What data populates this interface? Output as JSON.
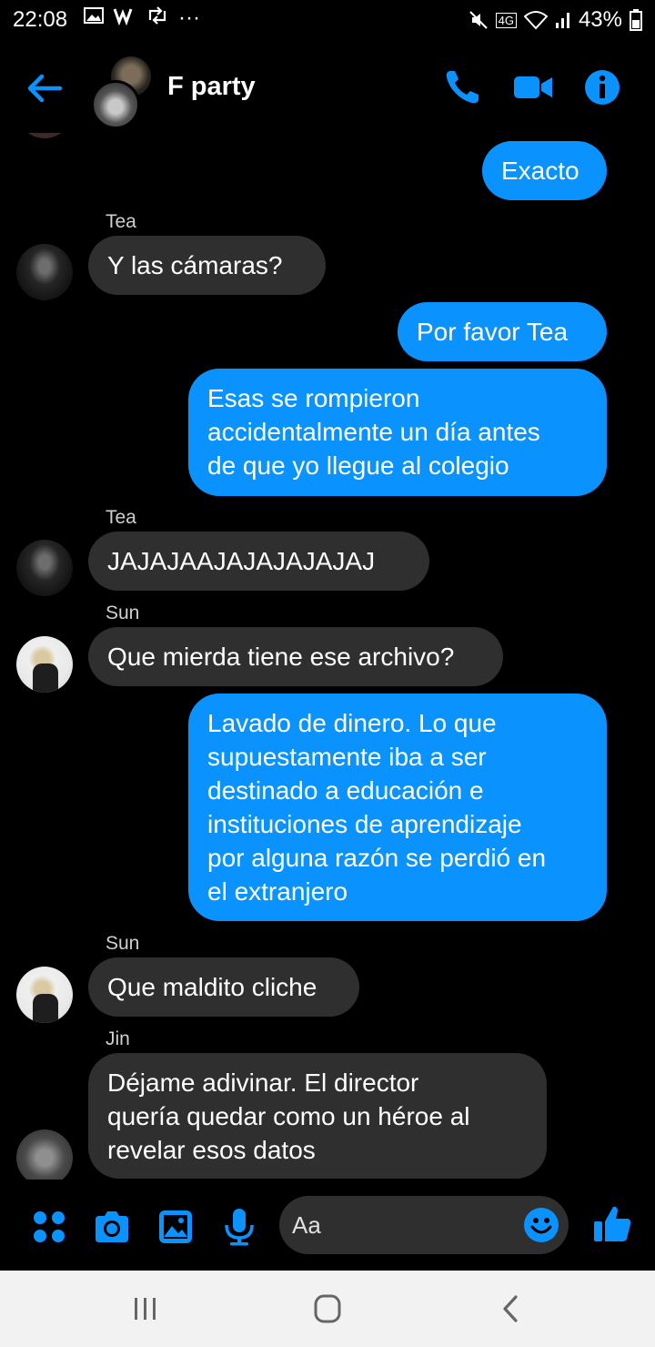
{
  "status_bar": {
    "time": "22:08",
    "battery": "43%",
    "network": "4G"
  },
  "header": {
    "title": "F party"
  },
  "messages": [
    {
      "type": "out",
      "text": "Exacto"
    },
    {
      "type": "sender",
      "text": "Tea"
    },
    {
      "type": "in",
      "text": "Y las cámaras?"
    },
    {
      "type": "out",
      "text": "Por favor Tea"
    },
    {
      "type": "out",
      "text": "Esas se rompieron\naccidentalmente un día antes\nde que yo llegue al colegio"
    },
    {
      "type": "sender",
      "text": "Tea"
    },
    {
      "type": "in",
      "text": "JAJAJAAJAJAJAJAJAJ"
    },
    {
      "type": "sender",
      "text": "Sun"
    },
    {
      "type": "in",
      "text": "Que mierda tiene ese archivo?"
    },
    {
      "type": "out",
      "text": "Lavado de dinero. Lo que\nsupuestamente iba a ser\ndestinado a educación e\ninstituciones de aprendizaje\npor alguna razón se perdió en\nel extranjero"
    },
    {
      "type": "sender",
      "text": "Sun"
    },
    {
      "type": "in",
      "text": "Que maldito cliche"
    },
    {
      "type": "sender",
      "text": "Jin"
    },
    {
      "type": "in",
      "text": "Déjame adivinar. El director\nquería quedar como un héroe al\nrevelar esos datos"
    }
  ],
  "composer": {
    "placeholder": "Aa"
  },
  "colors": {
    "accent": "#0a93ff",
    "incoming_bubble": "#2f2f2f",
    "background": "#000000"
  }
}
